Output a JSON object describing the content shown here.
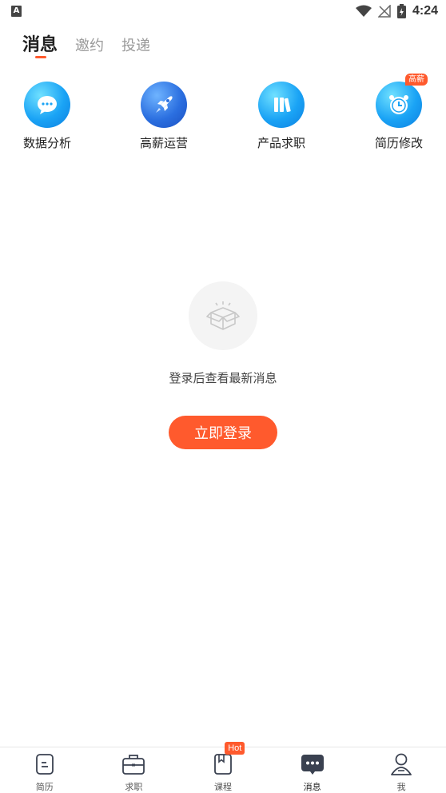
{
  "status_bar": {
    "app_icon_letter": "A",
    "time": "4:24",
    "icons": [
      "wifi-icon",
      "no-signal-icon",
      "battery-charging-icon"
    ]
  },
  "tabs": [
    {
      "label": "消息",
      "active": true
    },
    {
      "label": "邀约",
      "active": false
    },
    {
      "label": "投递",
      "active": false
    }
  ],
  "entries": [
    {
      "label": "数据分析",
      "icon": "chat-bubble-icon"
    },
    {
      "label": "高薪运营",
      "icon": "rocket-icon"
    },
    {
      "label": "产品求职",
      "icon": "books-icon"
    },
    {
      "label": "简历修改",
      "icon": "alarm-clock-icon",
      "badge": "高薪"
    }
  ],
  "empty_state": {
    "icon": "open-box-icon",
    "message": "登录后查看最新消息",
    "button_label": "立即登录"
  },
  "bottom_nav": [
    {
      "label": "简历",
      "icon": "resume-icon",
      "active": false
    },
    {
      "label": "求职",
      "icon": "briefcase-icon",
      "active": false
    },
    {
      "label": "课程",
      "icon": "course-book-icon",
      "active": false,
      "badge": "Hot"
    },
    {
      "label": "消息",
      "icon": "message-icon",
      "active": true
    },
    {
      "label": "我",
      "icon": "profile-icon",
      "active": false
    }
  ],
  "colors": {
    "accent": "#ff5a2d",
    "active_nav": "#3a4150",
    "icon_blue": "#1aa3f5"
  }
}
